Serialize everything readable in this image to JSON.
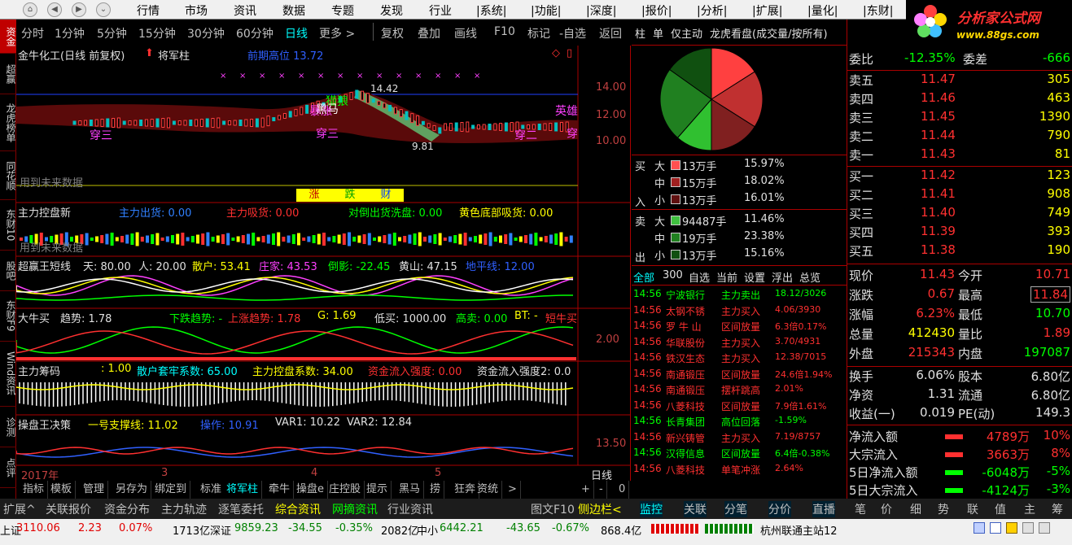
{
  "menu": {
    "items": [
      "行情",
      "市场",
      "资讯",
      "数据",
      "专题",
      "发现",
      "行业",
      "|系统|",
      "|功能|",
      "|深度|",
      "|报价|",
      "|分析|",
      "|扩展|",
      "|量化|",
      "|东财|"
    ]
  },
  "logo": {
    "title": "分析家公式网",
    "url": "www.88gs.com",
    "r6": "R 6"
  },
  "left_tabs": [
    {
      "label": "资金",
      "active": true
    },
    {
      "label": "超赢",
      "active": false
    },
    {
      "label": "龙虎榜单",
      "active": false
    },
    {
      "label": "同花顺",
      "active": false
    },
    {
      "label": "东财10",
      "active": false
    },
    {
      "label": "股吧",
      "active": false
    },
    {
      "label": "东财F9",
      "active": false
    },
    {
      "label": "Wind资讯",
      "active": false
    },
    {
      "label": "诊测",
      "active": false
    },
    {
      "label": "点评",
      "active": false
    }
  ],
  "toolbar": {
    "items": [
      "分时",
      "1分钟",
      "5分钟",
      "15分钟",
      "30分钟",
      "60分钟",
      "日线",
      "更多 >",
      "复权",
      "叠加",
      "画线",
      "F10",
      "标记",
      "-自选",
      "返回"
    ],
    "active": "日线"
  },
  "chart": {
    "title": "金牛化工(日线 前复权)",
    "indicator": "将军柱",
    "prev_high_label": "前期高位 13.72",
    "y_ticks": [
      "14.00",
      "12.00",
      "10.00"
    ],
    "high_label": "14.42",
    "low_label": "9.81",
    "future_label": "用到未来数据",
    "zhang_die_cai": [
      "涨",
      "跌",
      "财"
    ],
    "annot": [
      "猎狼",
      "型",
      "暴涨",
      "黑马",
      "五万",
      "穿三",
      "穿三",
      "穿二",
      "英雄",
      "穿"
    ],
    "p2": {
      "title": "主力控盘新",
      "a": "主力出货: 0.00",
      "b": "主力吸货: 0.00",
      "c": "对倒出货洗盘: 0.00",
      "d": "黄色底部吸货: 0.00",
      "future": "用到未来数据"
    },
    "p3": {
      "title": "超赢王短线",
      "a": "天: 80.00",
      "b": "人: 20.00",
      "c": "散户: 53.41",
      "d": "庄家: 43.53",
      "e": "倒影: -22.45",
      "f": "黄山: 47.15",
      "g": "地平线: 12.00",
      "h": "卖"
    },
    "p4": {
      "title": "大牛买",
      "a": "趋势: 1.78",
      "b": "下跌趋势: -",
      "c": "上涨趋势: 1.78",
      "d": "G: 1.69",
      "e": "低买: 1000.00",
      "f": "高卖: 0.00",
      "g": "BT: -",
      "h": "短牛买",
      "ytick": "2.00"
    },
    "p5": {
      "title": "主力筹码",
      "a": ": 1.00",
      "b": "散户套牢系数: 65.00",
      "c": "主力控盘系数: 34.00",
      "d": "资金流入强度: 0.00",
      "e": "资金流入强度2: 0.0"
    },
    "p6": {
      "title": "操盘王决策",
      "a": "一号支撑线: 11.02",
      "b": "操作: 10.91",
      "c": "VAR1: 10.22",
      "d": "VAR2: 12.84",
      "ytick": "13.50"
    },
    "time_axis": {
      "year": "2017年",
      "m3": "3",
      "m4": "4",
      "m5": "5",
      "period": "日线"
    }
  },
  "bottom_tabs": [
    "指标",
    "模板",
    "管理",
    "另存为",
    "绑定到",
    "标准",
    "将军柱",
    "牵牛",
    "操盘e",
    "庄控股",
    "提示",
    "黑马",
    "捞",
    "狂奔",
    "资统",
    ">",
    "+",
    "-",
    "0"
  ],
  "bottom_tabs_active": "将军柱",
  "bottom_tabs2": [
    "扩展^",
    "关联报价",
    "资金分布",
    "主力轨迹",
    "逐笔委托",
    "综合资讯",
    "网摘资讯",
    "行业资讯",
    "图文F10",
    "侧边栏<",
    "监控",
    "关联",
    "分笔",
    "分价",
    "直播",
    "笔",
    "价",
    "细",
    "势",
    "联",
    "值",
    "主",
    "筹"
  ],
  "mid": {
    "tabs": [
      "柱",
      "单",
      "仅主动",
      "龙虎看盘(成交量/按所有)"
    ],
    "buy": [
      {
        "size": "大",
        "vol": "13万手",
        "pct": "15.97%"
      },
      {
        "size": "中",
        "vol": "15万手",
        "pct": "18.02%"
      },
      {
        "size": "小",
        "vol": "13万手",
        "pct": "16.01%"
      }
    ],
    "sell": [
      {
        "size": "大",
        "vol": "94487手",
        "pct": "11.46%"
      },
      {
        "size": "中",
        "vol": "19万手",
        "pct": "23.38%"
      },
      {
        "size": "小",
        "vol": "13万手",
        "pct": "15.16%"
      }
    ],
    "buy_label": [
      "买",
      "入"
    ],
    "sell_label": [
      "卖",
      "出"
    ],
    "filter_tabs": [
      "全部",
      "300",
      "自选",
      "当前",
      "设置",
      "浮出",
      "总览"
    ],
    "ticks": [
      {
        "t": "14:56",
        "name": "宁波银行",
        "act": "主力卖出",
        "v": "18.12/3026",
        "c": "#00ff00"
      },
      {
        "t": "14:56",
        "name": "太钢不锈",
        "act": "主力买入",
        "v": "4.06/3930",
        "c": "#ff3030"
      },
      {
        "t": "14:56",
        "name": "罗 牛 山",
        "act": "区间放量",
        "v": "6.3倍0.17%",
        "c": "#ff3030"
      },
      {
        "t": "14:56",
        "name": "华联股份",
        "act": "主力买入",
        "v": "3.70/4931",
        "c": "#ff3030"
      },
      {
        "t": "14:56",
        "name": "铁汉生态",
        "act": "主力买入",
        "v": "12.38/7015",
        "c": "#ff3030"
      },
      {
        "t": "14:56",
        "name": "南通锻压",
        "act": "区间放量",
        "v": "24.6倍1.94%",
        "c": "#ff3030"
      },
      {
        "t": "14:56",
        "name": "南通锻压",
        "act": "摆杆跳高",
        "v": "2.01%",
        "c": "#ff3030"
      },
      {
        "t": "14:56",
        "name": "八菱科技",
        "act": "区间放量",
        "v": "7.9倍1.61%",
        "c": "#ff3030"
      },
      {
        "t": "14:56",
        "name": "长青集团",
        "act": "高位回落",
        "v": "-1.59%",
        "c": "#00ff00"
      },
      {
        "t": "14:56",
        "name": "新兴铸管",
        "act": "主力买入",
        "v": "7.19/8757",
        "c": "#ff3030"
      },
      {
        "t": "14:56",
        "name": "汉得信息",
        "act": "区间放量",
        "v": "6.4倍-0.38%",
        "c": "#00ff00"
      },
      {
        "t": "14:56",
        "name": "八菱科技",
        "act": "单笔冲涨",
        "v": "2.64%",
        "c": "#ff3030"
      }
    ],
    "pie": [
      {
        "label": "买大",
        "value": 15.97,
        "color": "#ff4040"
      },
      {
        "label": "买中",
        "value": 18.02,
        "color": "#c03030"
      },
      {
        "label": "买小",
        "value": 16.01,
        "color": "#802020"
      },
      {
        "label": "卖大",
        "value": 11.46,
        "color": "#30c030"
      },
      {
        "label": "卖中",
        "value": 23.38,
        "color": "#208020"
      },
      {
        "label": "卖小",
        "value": 15.16,
        "color": "#105010"
      }
    ]
  },
  "right": {
    "weibi": {
      "l": "委比",
      "v": "-12.35%",
      "l2": "委差",
      "v2": "-666"
    },
    "sell": [
      {
        "l": "卖五",
        "p": "11.47",
        "v": "305"
      },
      {
        "l": "卖四",
        "p": "11.46",
        "v": "463"
      },
      {
        "l": "卖三",
        "p": "11.45",
        "v": "1390"
      },
      {
        "l": "卖二",
        "p": "11.44",
        "v": "790"
      },
      {
        "l": "卖一",
        "p": "11.43",
        "v": "81"
      }
    ],
    "buy": [
      {
        "l": "买一",
        "p": "11.42",
        "v": "123"
      },
      {
        "l": "买二",
        "p": "11.41",
        "v": "908"
      },
      {
        "l": "买三",
        "p": "11.40",
        "v": "749"
      },
      {
        "l": "买四",
        "p": "11.39",
        "v": "393"
      },
      {
        "l": "买五",
        "p": "11.38",
        "v": "190"
      }
    ],
    "stats": [
      {
        "l": "现价",
        "v": "11.43",
        "l2": "今开",
        "v2": "10.71",
        "c": "#ff3030",
        "c2": "#ff3030"
      },
      {
        "l": "涨跌",
        "v": "0.67",
        "l2": "最高",
        "v2": "11.84",
        "c": "#ff3030",
        "c2": "#ff3030"
      },
      {
        "l": "涨幅",
        "v": "6.23%",
        "l2": "最低",
        "v2": "10.70",
        "c": "#ff3030",
        "c2": "#00ff00"
      },
      {
        "l": "总量",
        "v": "412430",
        "l2": "量比",
        "v2": "1.89",
        "c": "#ffff00",
        "c2": "#ff3030"
      },
      {
        "l": "外盘",
        "v": "215343",
        "l2": "内盘",
        "v2": "197087",
        "c": "#ff3030",
        "c2": "#00ff00"
      }
    ],
    "stats2": [
      {
        "l": "换手",
        "v": "6.06%",
        "l2": "股本",
        "v2": "6.80亿"
      },
      {
        "l": "净资",
        "v": "1.31",
        "l2": "流通",
        "v2": "6.80亿"
      },
      {
        "l": "收益(一)",
        "v": "0.019",
        "l2": "PE(动)",
        "v2": "149.3"
      }
    ],
    "flows": [
      {
        "l": "净流入额",
        "v": "4789万",
        "p": "10%",
        "c": "#ff3030"
      },
      {
        "l": "大宗流入",
        "v": "3663万",
        "p": "8%",
        "c": "#ff3030"
      },
      {
        "l": "5日净流入额",
        "v": "-6048万",
        "p": "-5%",
        "c": "#00ff00"
      },
      {
        "l": "5日大宗流入",
        "v": "-4124万",
        "p": "-3%",
        "c": "#00ff00"
      }
    ]
  },
  "status": {
    "sh_label": "上证",
    "sh": "3110.06",
    "sh_chg": "2.23",
    "sh_pct": "0.07%",
    "sh_amt": "1713亿",
    "sz_label": "深证",
    "sz": "9859.23",
    "sz_chg": "-34.55",
    "sz_pct": "-0.35%",
    "sz_amt": "2082亿",
    "zx_label": "中小",
    "zx": "6442.21",
    "zx_chg": "-43.65",
    "zx_pct": "-0.67%",
    "zx_amt": "868.4亿",
    "server": "杭州联通主站12"
  }
}
